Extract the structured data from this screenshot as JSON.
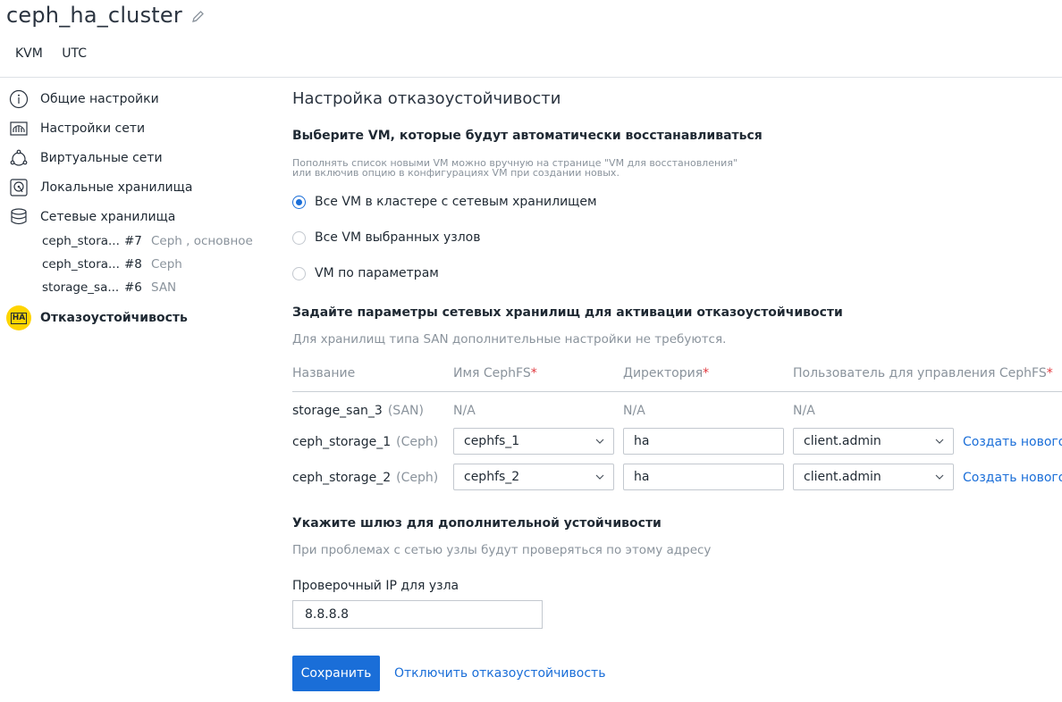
{
  "header": {
    "title": "ceph_ha_cluster",
    "tags": [
      "KVM",
      "UTC"
    ]
  },
  "sidebar": {
    "items": [
      {
        "label": "Общие настройки",
        "icon": "info-icon"
      },
      {
        "label": "Настройки сети",
        "icon": "network-settings-icon"
      },
      {
        "label": "Виртуальные сети",
        "icon": "virtual-network-icon"
      },
      {
        "label": "Локальные хранилища",
        "icon": "local-storage-icon"
      },
      {
        "label": "Сетевые хранилища",
        "icon": "network-storage-icon"
      }
    ],
    "storages": [
      {
        "name": "ceph_stora...",
        "id": "#7",
        "type": "Ceph , основное"
      },
      {
        "name": "ceph_stora...",
        "id": "#8",
        "type": "Ceph"
      },
      {
        "name": "storage_sa...",
        "id": "#6",
        "type": "SAN"
      }
    ],
    "active_item": {
      "label": "Отказоустойчивость",
      "badge": "HA"
    }
  },
  "main": {
    "title": "Настройка отказоустойчивости",
    "vm_section": {
      "heading": "Выберите VM, которые будут автоматически восстанавливаться",
      "hint_line1": "Пополнять список новыми VM можно вручную на странице \"VM для восстановления\"",
      "hint_line2": "или включив опцию в конфигурациях VM при создании новых.",
      "options": [
        {
          "label": "Все VM в кластере с сетевым хранилищем",
          "checked": true
        },
        {
          "label": "Все VM выбранных узлов",
          "checked": false
        },
        {
          "label": "VM по параметрам",
          "checked": false
        }
      ]
    },
    "storage_section": {
      "heading": "Задайте параметры сетевых хранилищ для активации отказоустойчивости",
      "note": "Для хранилищ типа SAN дополнительные настройки не требуются.",
      "columns": {
        "name": "Название",
        "cephfs": "Имя CephFS",
        "directory": "Директория",
        "user": "Пользователь для управления CephFS",
        "required_mark": "*"
      },
      "rows": [
        {
          "name": "storage_san_3",
          "type": "(SAN)",
          "cephfs": "N/A",
          "directory": "N/A",
          "user": "N/A"
        },
        {
          "name": "ceph_storage_1",
          "type": "(Ceph)",
          "cephfs": "cephfs_1",
          "directory": "ha",
          "user": "client.admin",
          "link": "Создать нового"
        },
        {
          "name": "ceph_storage_2",
          "type": "(Ceph)",
          "cephfs": "cephfs_2",
          "directory": "ha",
          "user": "client.admin",
          "link": "Создать нового"
        }
      ]
    },
    "gateway_section": {
      "heading": "Укажите шлюз для дополнительной устойчивости",
      "note": "При проблемах с сетью узлы будут проверяться по этому адресу",
      "ip_label": "Проверочный IP для узла",
      "ip_value": "8.8.8.8"
    },
    "actions": {
      "save": "Сохранить",
      "disable": "Отключить отказоустойчивость"
    }
  },
  "colors": {
    "accent": "#1a6ed8",
    "badge": "#ffd400",
    "required": "#e0373d"
  }
}
